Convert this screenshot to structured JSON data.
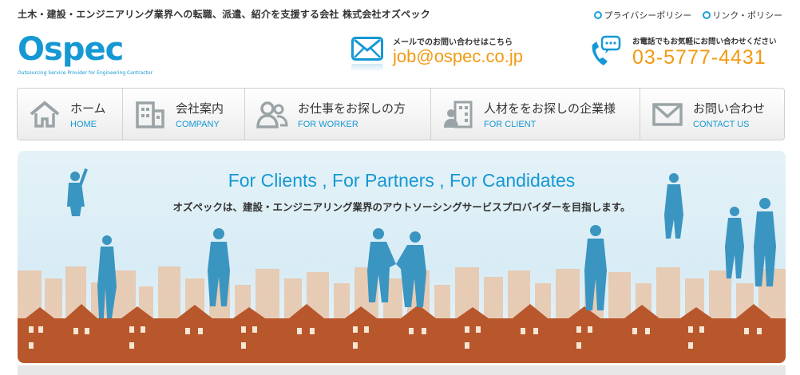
{
  "header": {
    "tagline": "土木・建設・エンジニアリング業界への転職、派遣、紹介を支援する会社 株式会社オズペック",
    "links": [
      {
        "label": "プライバシーポリシー"
      },
      {
        "label": "リンク・ポリシー"
      }
    ],
    "logo": {
      "text": "Ospec",
      "subtitle": "Outsourcing Service Provider for Engineering Contractor"
    },
    "mail": {
      "caption": "メールでのお問い合わせはこちら",
      "address": "job@ospec.co.jp",
      "icon": "envelope-icon"
    },
    "phone": {
      "caption": "お電話でもお気軽にお問い合わせください",
      "number": "03-5777-4431",
      "icon": "phone-icon"
    }
  },
  "nav": {
    "items": [
      {
        "jp": "ホーム",
        "en": "HOME",
        "icon": "house-icon"
      },
      {
        "jp": "会社案内",
        "en": "COMPANY",
        "icon": "building-icon"
      },
      {
        "jp": "お仕事をお探しの方",
        "en": "FOR WORKER",
        "icon": "people-icon"
      },
      {
        "jp": "人材ををお探しの企業様",
        "en": "FOR CLIENT",
        "icon": "office-person-icon"
      },
      {
        "jp": "お問い合わせ",
        "en": "CONTACT US",
        "icon": "envelope-icon"
      }
    ]
  },
  "hero": {
    "title": "For Clients , For Partners , For Candidates",
    "subtitle": "オズペックは、建設・エンジニアリング業界のアウトソーシングサービスプロバイダーを目指します。"
  },
  "colors": {
    "brand": "#1598d4",
    "accent": "#f29a12",
    "hero_bg": "#dcedf6",
    "town": "#b8562c"
  }
}
